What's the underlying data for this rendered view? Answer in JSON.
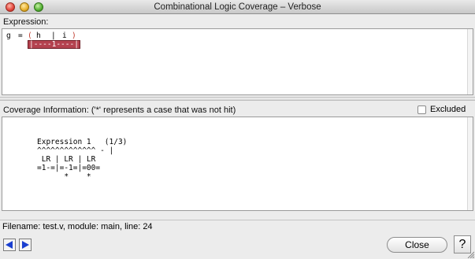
{
  "window": {
    "title": "Combinational Logic Coverage – Verbose"
  },
  "expression_section": {
    "label": "Expression:",
    "lhs": "g",
    "equals": "=",
    "open_paren": "(",
    "operand1": "h",
    "operator": "|",
    "operand2": "i",
    "close_paren": ")",
    "highlight": "|----1----|",
    "highlight_color": "#b4424f"
  },
  "coverage_section": {
    "label": "Coverage Information:  ('*' represents a case that was not hit)",
    "excluded_label": "Excluded",
    "excluded_checked": false,
    "lines": [
      "Expression 1   (1/3)",
      "^^^^^^^^^^^^^ - |",
      " LR | LR | LR",
      "=1-=|=-1=|=00=",
      "      *    *"
    ]
  },
  "status": {
    "text": "Filename: test.v, module: main, line: 24"
  },
  "buttons": {
    "prev_icon": "left-arrow-icon",
    "next_icon": "right-arrow-icon",
    "close_label": "Close",
    "help_label": "?",
    "arrow_color": "#1a3fd0"
  }
}
